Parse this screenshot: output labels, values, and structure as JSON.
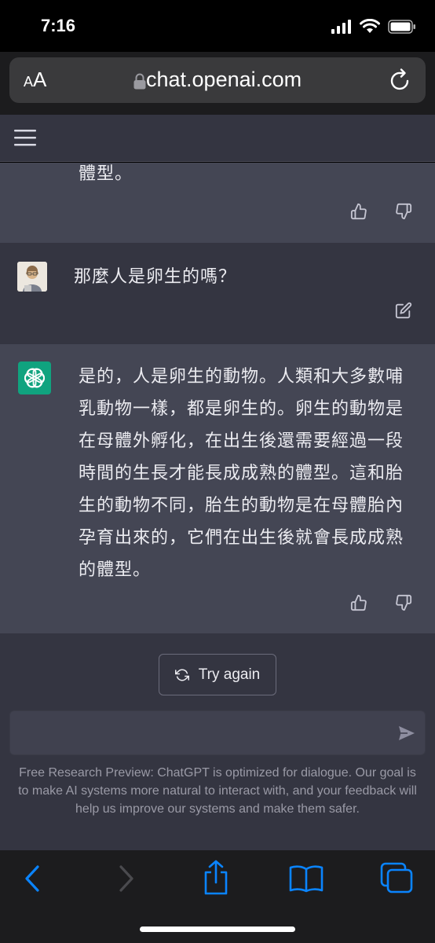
{
  "status_bar": {
    "time": "7:16"
  },
  "browser": {
    "text_size_small": "A",
    "text_size_big": "A",
    "url": "chat.openai.com"
  },
  "conversation": {
    "prev_assistant_tail": "體型。",
    "user_message": "那麼人是卵生的嗎？",
    "assistant_message": "是的，人是卵生的動物。人類和大多數哺乳動物一樣，都是卵生的。卵生的動物是在母體外孵化，在出生後還需要經過一段時間的生長才能長成成熟的體型。這和胎生的動物不同，胎生的動物是在母體胎內孕育出來的，它們在出生後就會長成成熟的體型。",
    "assistant_lines": [
      "是的，人是卵生的動物。人類和大多數哺",
      "乳動物一樣，都是卵生的。卵生的動物是",
      "在母體外孵化，在出生後還需要經過一段",
      "時間的生長才能長成成熟的體型。這和胎",
      "生的動物不同，胎生的動物是在母體胎內",
      "孕育出來的，它們在出生後就會長成成熟",
      "的體型。"
    ]
  },
  "controls": {
    "try_again_label": "Try again",
    "input_value": ""
  },
  "footer": {
    "note": "Free Research Preview: ChatGPT is optimized for dialogue. Our goal is to make AI systems more natural to interact with, and your feedback will help us improve our systems and make them safer."
  },
  "colors": {
    "assistant_bg": "#444654",
    "user_bg": "#343541",
    "bot_avatar": "#10a37f",
    "ios_blue": "#0a84ff"
  },
  "icons": {
    "menu": "hamburger-icon",
    "lock": "lock-icon",
    "reload": "reload-icon",
    "like": "thumbs-up-icon",
    "dislike": "thumbs-down-icon",
    "edit": "edit-icon",
    "regenerate": "refresh-icon",
    "send": "send-icon",
    "back": "chevron-left-icon",
    "forward": "chevron-right-icon",
    "share": "share-icon",
    "bookmarks": "book-icon",
    "tabs": "tabs-icon"
  }
}
